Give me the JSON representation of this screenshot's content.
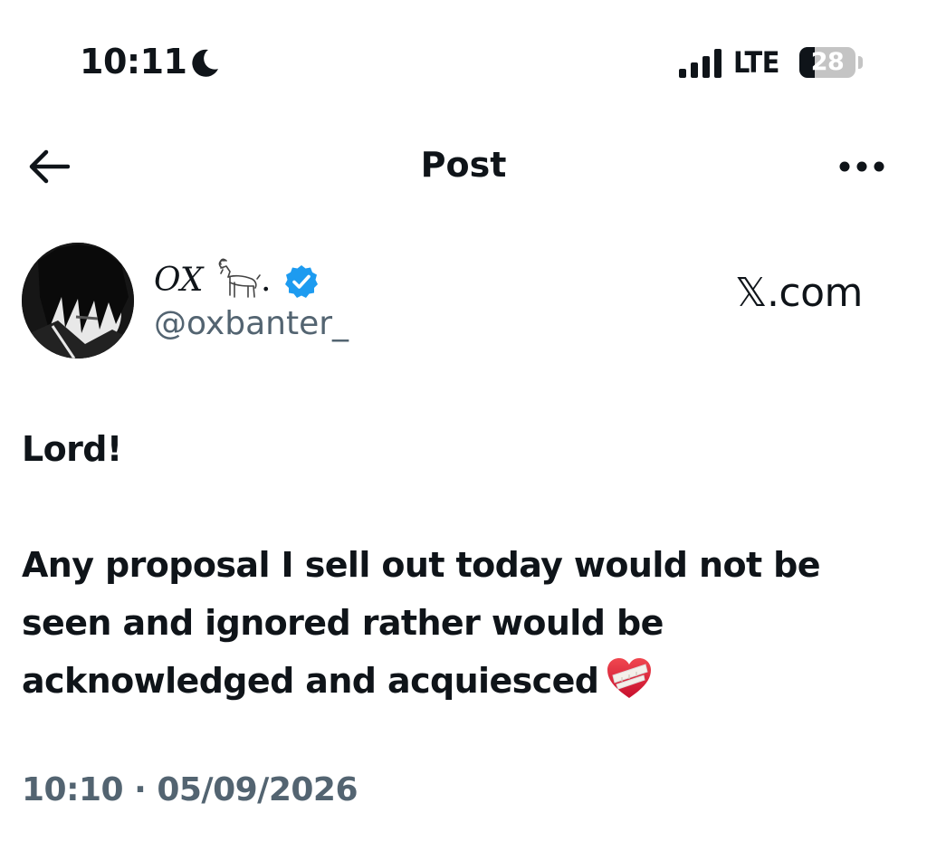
{
  "status_bar": {
    "time": "10:11",
    "moon_icon": "moon-icon",
    "signal_icon": "signal-bars-icon",
    "network": "LTE",
    "battery_level": "28",
    "battery_fraction": 0.28
  },
  "header": {
    "back_icon": "back-arrow-icon",
    "title": "Post",
    "more_icon": "more-horizontal-icon"
  },
  "author": {
    "display_name": "OX",
    "name_emoji": "goat",
    "name_suffix": ".",
    "verified": true,
    "handle": "@oxbanter_",
    "avatar_icon": "avatar"
  },
  "brand": {
    "label": "𝕏.com"
  },
  "post": {
    "lines": [
      "Lord!",
      "",
      "Any proposal I sell out today would not be",
      "seen and ignored rather would be",
      "acknowledged and acquiesced"
    ],
    "trailing_emoji": "mending-heart"
  },
  "timestamp": "10:10 · 05/09/2026",
  "colors": {
    "text": "#0f1419",
    "secondary": "#536471",
    "verified": "#1d9bf0",
    "battery": "#c4c4c4"
  }
}
